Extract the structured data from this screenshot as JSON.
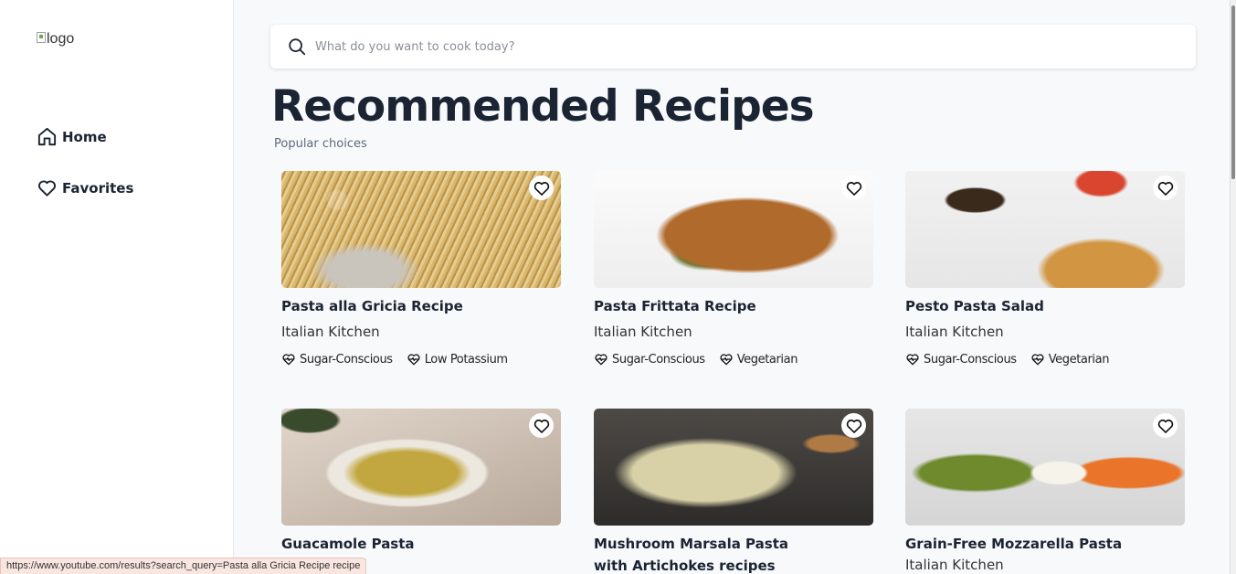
{
  "sidebar": {
    "logo_alt": "logo",
    "nav": [
      {
        "label": "Home",
        "icon": "home-icon"
      },
      {
        "label": "Favorites",
        "icon": "heart-icon"
      }
    ]
  },
  "search": {
    "placeholder": "What do you want to cook today?",
    "value": ""
  },
  "header": {
    "title": "Recommended Recipes",
    "subtitle": "Popular choices"
  },
  "recipes": [
    {
      "title": "Pasta alla Gricia Recipe",
      "cuisine": "Italian Kitchen",
      "tags": [
        "Sugar-Conscious",
        "Low Potassium"
      ]
    },
    {
      "title": "Pasta Frittata Recipe",
      "cuisine": "Italian Kitchen",
      "tags": [
        "Sugar-Conscious",
        "Vegetarian"
      ]
    },
    {
      "title": "Pesto Pasta Salad",
      "cuisine": "Italian Kitchen",
      "tags": [
        "Sugar-Conscious",
        "Vegetarian"
      ]
    },
    {
      "title": "Guacamole Pasta",
      "cuisine": "",
      "tags": []
    },
    {
      "title": "Mushroom Marsala Pasta with Artichokes recipes",
      "cuisine": "",
      "tags": []
    },
    {
      "title": "Grain-Free Mozzarella Pasta",
      "cuisine": "Italian Kitchen",
      "tags": []
    }
  ],
  "status_bar": {
    "url": "https://www.youtube.com/results?search_query=Pasta alla Gricia Recipe recipe"
  }
}
